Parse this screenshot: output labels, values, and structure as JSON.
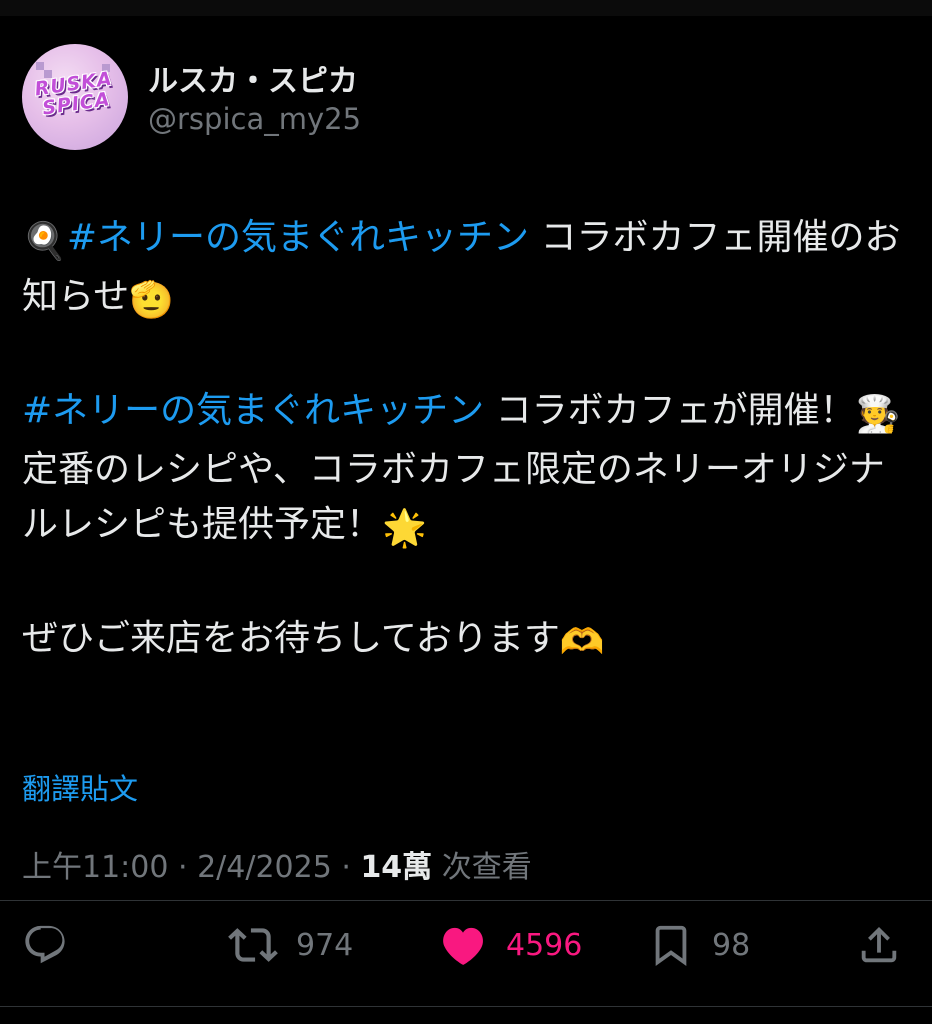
{
  "author": {
    "display_name": "ルスカ・スピカ",
    "handle": "@rspica_my25",
    "avatar_text_line1": "RUSKA",
    "avatar_text_line2": "SPICA"
  },
  "post": {
    "line1_emoji": "🍳",
    "line1_tag": "#ネリーの気まぐれキッチン",
    "line1_text": " コラボカフェ開催のお知らせ",
    "line1_end_emoji": "🫡",
    "line2_tag": "#ネリーの気まぐれキッチン",
    "line2_text": " コラボカフェが開催！",
    "line2_emoji": "🧑‍🍳",
    "line3_text": "定番のレシピや、コラボカフェ限定のネリーオリジナルレシピも提供予定！",
    "line3_emoji": "🌟",
    "line4_text": "ぜひご来店をお待ちしております",
    "line4_emoji": "🫶"
  },
  "translate_label": "翻譯貼文",
  "meta": {
    "time": "上午11:00",
    "date": "2/4/2025",
    "separator": " · ",
    "views_count": "14萬",
    "views_label": " 次查看"
  },
  "actions": {
    "retweets": "974",
    "likes": "4596",
    "bookmarks": "98"
  },
  "colors": {
    "background": "#000000",
    "text": "#e7e9ea",
    "secondary": "#71767b",
    "link": "#1d9bf0",
    "like": "#f91880"
  },
  "icons": [
    "reply-icon",
    "retweet-icon",
    "heart-icon",
    "bookmark-icon",
    "share-icon"
  ]
}
